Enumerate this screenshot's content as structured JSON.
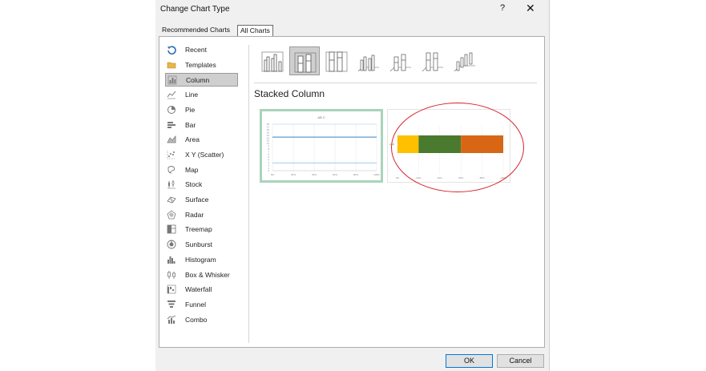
{
  "dialog": {
    "title": "Change Chart Type",
    "help": "?",
    "close": "✕"
  },
  "tabs": [
    {
      "label": "Recommended Charts"
    },
    {
      "label": "All Charts"
    }
  ],
  "sidebar": {
    "selected": "Column",
    "items": [
      {
        "label": "Recent",
        "icon": "recent-icon"
      },
      {
        "label": "Templates",
        "icon": "folder-icon"
      },
      {
        "label": "Column",
        "icon": "column-chart-icon"
      },
      {
        "label": "Line",
        "icon": "line-chart-icon"
      },
      {
        "label": "Pie",
        "icon": "pie-chart-icon"
      },
      {
        "label": "Bar",
        "icon": "bar-chart-icon"
      },
      {
        "label": "Area",
        "icon": "area-chart-icon"
      },
      {
        "label": "X Y (Scatter)",
        "icon": "scatter-chart-icon"
      },
      {
        "label": "Map",
        "icon": "map-chart-icon"
      },
      {
        "label": "Stock",
        "icon": "stock-chart-icon"
      },
      {
        "label": "Surface",
        "icon": "surface-chart-icon"
      },
      {
        "label": "Radar",
        "icon": "radar-chart-icon"
      },
      {
        "label": "Treemap",
        "icon": "treemap-chart-icon"
      },
      {
        "label": "Sunburst",
        "icon": "sunburst-chart-icon"
      },
      {
        "label": "Histogram",
        "icon": "histogram-chart-icon"
      },
      {
        "label": "Box & Whisker",
        "icon": "box-whisker-chart-icon"
      },
      {
        "label": "Waterfall",
        "icon": "waterfall-chart-icon"
      },
      {
        "label": "Funnel",
        "icon": "funnel-chart-icon"
      },
      {
        "label": "Combo",
        "icon": "combo-chart-icon"
      }
    ]
  },
  "subtypes": {
    "selected_title": "Stacked Column",
    "items": [
      "clustered-column-icon",
      "stacked-column-icon",
      "100-stacked-column-icon",
      "3d-clustered-column-icon",
      "3d-stacked-column-icon",
      "3d-100-stacked-column-icon",
      "3d-column-icon"
    ]
  },
  "previews": {
    "preview1": {
      "title": "AB C",
      "y_ticks": [
        "18",
        "17",
        "16",
        "15",
        "14",
        "13",
        "12",
        "11",
        "9",
        "8",
        "7",
        "6",
        "5",
        "4",
        "3",
        "2",
        "1",
        "0"
      ],
      "x_ticks": [
        "0%",
        "20%",
        "40%",
        "60%",
        "80%",
        "100%"
      ]
    },
    "preview2": {
      "category_label": "A&B",
      "x_ticks": [
        "0%",
        "20%",
        "40%",
        "60%",
        "80%",
        "100%"
      ]
    }
  },
  "chart_data": [
    {
      "type": "line",
      "title": "AB C",
      "x": [
        "0%",
        "20%",
        "40%",
        "60%",
        "80%",
        "100%"
      ],
      "y_ticks": [
        "18",
        "17",
        "16",
        "15",
        "14",
        "13",
        "12",
        "11",
        "9",
        "8",
        "7",
        "6",
        "5",
        "4",
        "3",
        "2",
        "1",
        "0"
      ],
      "series": [
        {
          "color": "#5b9bd5",
          "level": 13
        },
        {
          "color": "#9dc3e6",
          "level": 3
        }
      ]
    },
    {
      "type": "bar",
      "stacked": true,
      "categories": [
        "A&B"
      ],
      "x_ticks": [
        "0%",
        "20%",
        "40%",
        "60%",
        "80%",
        "100%"
      ],
      "xlim": [
        0,
        1
      ],
      "series": [
        {
          "values": [
            0.2
          ],
          "color": "#ffc000"
        },
        {
          "values": [
            0.4
          ],
          "color": "#4a7a2e"
        },
        {
          "values": [
            0.4
          ],
          "color": "#d86614"
        }
      ]
    }
  ],
  "buttons": {
    "ok": "OK",
    "cancel": "Cancel"
  }
}
